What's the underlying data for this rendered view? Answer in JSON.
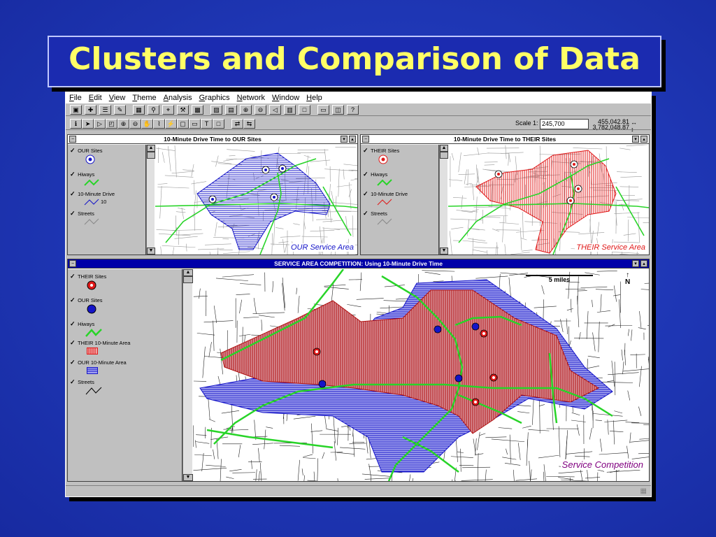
{
  "slide": {
    "title": "Clusters and Comparison of Data"
  },
  "app": {
    "menus": [
      "File",
      "Edit",
      "View",
      "Theme",
      "Analysis",
      "Graphics",
      "Network",
      "Window",
      "Help"
    ],
    "toolbar_buttons_row1": [
      "save-icon",
      "add-theme-icon",
      "theme-properties-icon",
      "edit-legend-icon",
      "open-table-icon",
      "find-icon",
      "locate-address-icon",
      "query-builder-icon",
      "zoom-full-extent-icon",
      "zoom-active-themes-icon",
      "zoom-selected-icon",
      "zoom-in-icon",
      "zoom-out-icon",
      "zoom-previous-icon",
      "select-by-theme-icon",
      "clear-selection-icon",
      "layout-icon",
      "chart-icon",
      "help-cursor-icon"
    ],
    "toolbar_buttons_row2": [
      "identify-icon",
      "pointer-icon",
      "vertex-edit-icon",
      "select-feature-icon",
      "zoom-in-tool-icon",
      "zoom-out-tool-icon",
      "pan-icon",
      "measure-icon",
      "hotlink-icon",
      "area-of-interest-icon",
      "label-icon",
      "text-tool-icon",
      "draw-icon",
      "network-find-route-icon",
      "network-find-closest-icon"
    ],
    "scale_label": "Scale 1:",
    "scale_value": "245,700",
    "coord_x": "455,042.81",
    "coord_y": "3,782,048.87"
  },
  "windows": {
    "our": {
      "title": "10-Minute Drive Time to OUR Sites",
      "legend": [
        {
          "label": "OUR Sites"
        },
        {
          "label": "Hiways"
        },
        {
          "label": "10-Minute Drive",
          "value": "10"
        },
        {
          "label": "Streets"
        }
      ],
      "caption": "OUR Service Area"
    },
    "their": {
      "title": "10-Minute Drive Time to THEIR Sites",
      "legend": [
        {
          "label": "THEIR Sites"
        },
        {
          "label": "Hiways"
        },
        {
          "label": "10-Minute Drive"
        },
        {
          "label": "Streets"
        }
      ],
      "caption": "THEIR Service Area"
    },
    "competition": {
      "title": "SERVICE AREA COMPETITION:  Using 10-Minute Drive Time",
      "legend": [
        {
          "label": "THEIR Sites"
        },
        {
          "label": "OUR Sites"
        },
        {
          "label": "Hiways"
        },
        {
          "label": "THEIR 10-Minute Area"
        },
        {
          "label": "OUR 10-Minute Area"
        },
        {
          "label": "Streets"
        }
      ],
      "scalebar": "5 miles",
      "north": "N",
      "caption": "Service Competition"
    }
  },
  "colors": {
    "our": "#1414c8",
    "their": "#e01818",
    "hiways": "#28d428",
    "purple_caption": "#800080",
    "title_yellow": "#ffff66"
  }
}
